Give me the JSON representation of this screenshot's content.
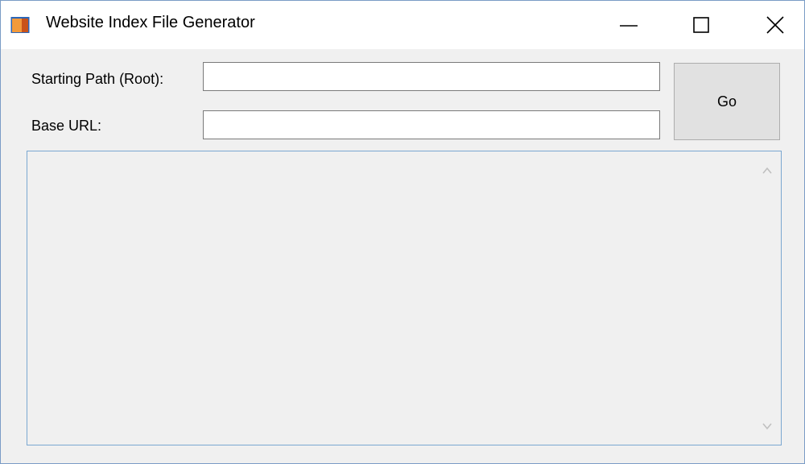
{
  "window": {
    "title": "Website Index File Generator",
    "icon": "folder-app-icon"
  },
  "caption": {
    "minimize_icon": "minimize-icon",
    "maximize_icon": "maximize-icon",
    "close_icon": "close-icon"
  },
  "form": {
    "starting_path_label": "Starting Path (Root):",
    "starting_path_value": "",
    "base_url_label": "Base URL:",
    "base_url_value": "",
    "go_label": "Go"
  },
  "output": {
    "text": "",
    "scroll_up_icon": "chevron-up-icon",
    "scroll_down_icon": "chevron-down-icon"
  },
  "colors": {
    "window_border": "#7a9cc6",
    "client_background": "#f0f0f0",
    "output_border": "#7aa7d1",
    "button_background": "#e1e1e1"
  }
}
